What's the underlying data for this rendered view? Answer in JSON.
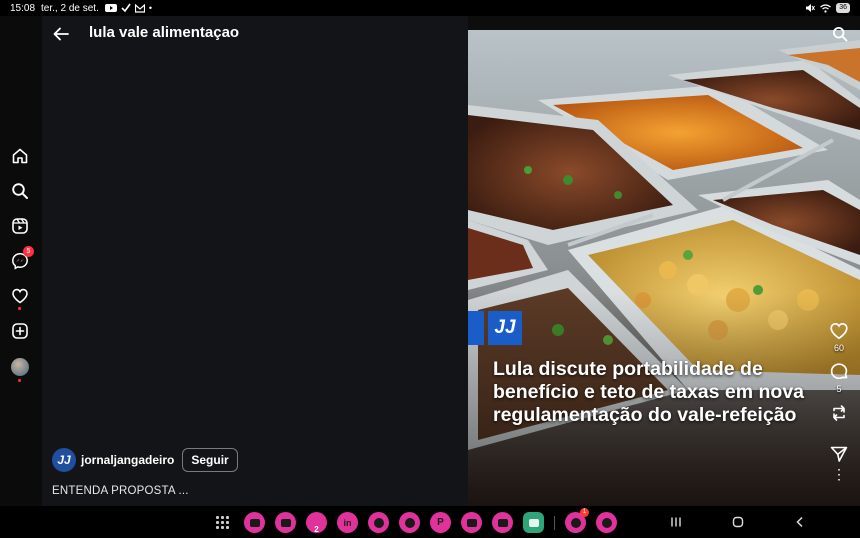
{
  "status_bar": {
    "time": "15:08",
    "date": "ter., 2 de set.",
    "battery": "36"
  },
  "header": {
    "search_query": "lula vale alimentaçao"
  },
  "nav_rail": {
    "messages_badge": "5"
  },
  "post": {
    "author": "jornaljangadeiro",
    "author_initials": "JJ",
    "follow_label": "Seguir",
    "caption": "ENTENDA PROPOSTA ...",
    "headline": "Lula discute portabilidade de benefício e teto de taxas em nova regulamentação do vale-refeição",
    "logo_text": "JJ",
    "likes": "60",
    "comments": "5",
    "reposts": ""
  },
  "taskbar": {
    "calendar_number": "2",
    "notification_badge": "1"
  },
  "colors": {
    "accent_pink": "#e0329b",
    "badge_red": "#ff3040",
    "brand_blue": "#1a5cc8"
  }
}
